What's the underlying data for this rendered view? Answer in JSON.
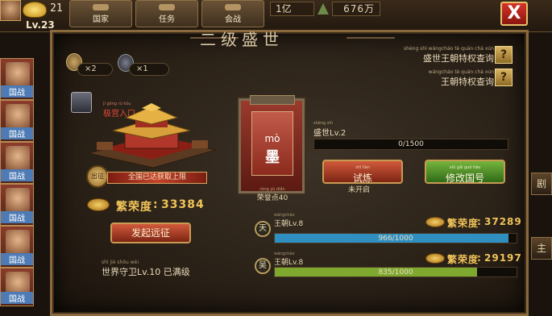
{
  "hud": {
    "gold": "21",
    "level": "Lv.23",
    "res_1": "1亿",
    "res_2": "676万",
    "tabs": [
      {
        "label": "国家"
      },
      {
        "label": "任务"
      },
      {
        "label": "会战"
      }
    ],
    "close": "X"
  },
  "left_strip": {
    "items": [
      {
        "tag": "国战"
      },
      {
        "tag": "国战"
      },
      {
        "tag": "国战"
      },
      {
        "tag": "国战"
      },
      {
        "tag": "国战"
      },
      {
        "tag": "国战"
      }
    ]
  },
  "right_strip": [
    "剧",
    "主"
  ],
  "panel": {
    "title": "二级盛世",
    "items": [
      {
        "count": "×2",
        "icon": "coin-bag-icon"
      },
      {
        "count": "×1",
        "icon": "bomb-icon"
      }
    ],
    "queries": [
      {
        "pinyin": "shèng shì wángcháo tè quán chá xún",
        "text": "盛世王朝特权查询"
      },
      {
        "pinyin": "wángcháo tè quán chá xún",
        "text": "王朝特权查询"
      }
    ],
    "query_btn": "?",
    "palace": {
      "label_pinyin": "jí gōng rù kǒu",
      "label": "极宫入口",
      "seal": "出征",
      "banner": "全国已达获取上限",
      "prosperity_label": "繁荣度",
      "prosperity_value": "33384",
      "expedition_btn": "发起远征",
      "guard_pinyin": "shì jiè shǒu wèi",
      "guard_text": "世界守卫Lv.10 已满级"
    },
    "plaque": {
      "pinyin": "mò",
      "char": "墨",
      "points_pinyin": "róng yù diǎn",
      "points": "荣誉点40"
    },
    "age": {
      "pinyin": "shèng shì",
      "label": "盛世Lv.2",
      "progress_text": "0/1500",
      "progress": 0.0,
      "trial_btn_pinyin": "shì liàn",
      "trial_btn": "试炼",
      "rename_btn_pinyin": "xiū gǎi guó hào",
      "rename_btn": "修改国号",
      "unopened": "未开启"
    },
    "dynasties": [
      {
        "badge": "天",
        "badge_pinyin": "tiān",
        "name_pinyin": "wángcháo",
        "name": "王朝Lv.8",
        "prosperity_label": "繁荣度",
        "prosperity_value": "37289",
        "progress_text": "966/1000",
        "progress": 0.966,
        "color": "#2f8fc0"
      },
      {
        "badge": "吴",
        "badge_pinyin": "wú",
        "name_pinyin": "wángcháo",
        "name": "王朝Lv.8",
        "prosperity_label": "繁荣度",
        "prosperity_value": "29197",
        "progress_text": "835/1000",
        "progress": 0.835,
        "color": "#7fa82f"
      }
    ]
  },
  "colors": {
    "frame": "#8a6a3d",
    "prosperity": "#f0c35a",
    "close": "#c02a20"
  }
}
